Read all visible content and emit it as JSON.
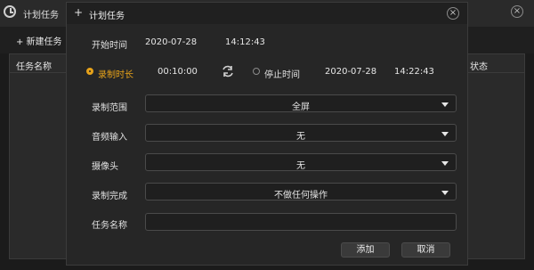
{
  "background_window": {
    "title": "计划任务",
    "toolbar": {
      "new_task_label": "+ 新建任务"
    },
    "table": {
      "columns": [
        "任务名称",
        "状态"
      ]
    },
    "close_icon": "close-icon"
  },
  "dialog": {
    "title_icon": "plus-icon",
    "title": "计划任务",
    "close_icon": "close-icon",
    "start": {
      "label": "开始时间",
      "date": "2020-07-28",
      "time": "14:12:43"
    },
    "mode": {
      "record_duration": {
        "label": "录制时长",
        "value": "00:10:00",
        "selected": true
      },
      "swap_icon": "swap-arrows-icon",
      "stop_time": {
        "label": "停止时间",
        "date": "2020-07-28",
        "time": "14:22:43",
        "selected": false
      }
    },
    "fields": {
      "record_scope": {
        "label": "录制范围",
        "value": "全屏"
      },
      "audio_input": {
        "label": "音频输入",
        "value": "无"
      },
      "camera": {
        "label": "摄像头",
        "value": "无"
      },
      "on_complete": {
        "label": "录制完成",
        "value": "不做任何操作"
      },
      "task_name": {
        "label": "任务名称",
        "value": ""
      }
    },
    "buttons": {
      "add": "添加",
      "cancel": "取消"
    },
    "colors": {
      "accent": "#e6a21a",
      "dialog_bg": "#262626",
      "field_bg": "#1f1f1f"
    }
  }
}
